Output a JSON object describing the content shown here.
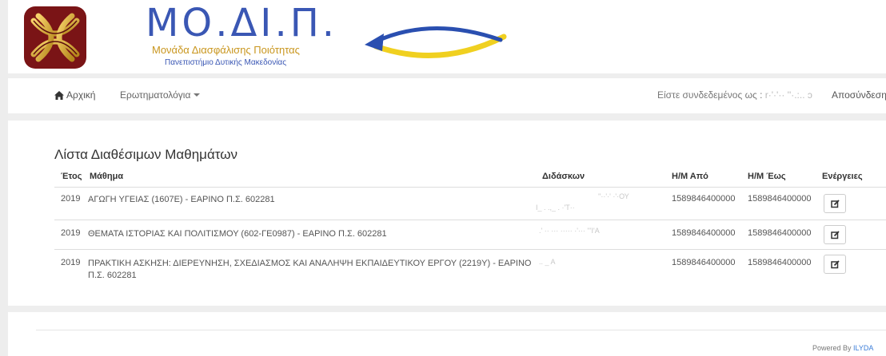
{
  "header": {
    "logo_title": "ΜΟ.ΔΙ.Π.",
    "logo_subtitle": "Μονάδα Διασφάλισης Ποιότητας",
    "logo_university": "Πανεπιστήμιο Δυτικής Μακεδονίας"
  },
  "navbar": {
    "home_label": "Αρχική",
    "questionnaires_label": "Ερωτηματολόγια",
    "logged_in_label": "Είστε συνδεδεμένος ως :",
    "username_blurred": "r·'·'·· ''·.:.. ͻ",
    "logout_label": "Αποσύνδεση"
  },
  "panel": {
    "title": "Λίστα Διαθέσιμων Μαθημάτων",
    "columns": {
      "year": "Έτος",
      "course": "Μάθημα",
      "teacher": "Διδάσκων",
      "from": "Η/Μ Από",
      "to": "Η/Μ Έως",
      "actions": "Ενέργειες"
    },
    "rows": [
      {
        "year": "2019",
        "course": "ΑΓΩΓΗ ΥΓΕΙΑΣ (1607Ε) - ΕΑΡΙΝΟ Π.Σ. 602281",
        "teacher_line1": "''··'·' ·'·ΟΥ",
        "teacher_line2": "Ι_ . .,_ . ·'Τ··",
        "from": "1589846400000",
        "to": "1589846400000"
      },
      {
        "year": "2019",
        "course": "ΘΕΜΑΤΑ ΙΣΤΟΡΙΑΣ ΚΑΙ ΠΟΛΙΤΙΣΜΟΥ (602-ΓΕ0987) - ΕΑΡΙΝΟ Π.Σ. 602281",
        "teacher_line1": ".' ·· ···  ····· ·'···  '''Ι'Α",
        "teacher_line2": "",
        "from": "1589846400000",
        "to": "1589846400000"
      },
      {
        "year": "2019",
        "course": "ΠΡΑΚΤΙΚΗ ΑΣΚΗΣΗ: ΔΙΕΡΕΥΝΗΣΗ, ΣΧΕΔΙΑΣΜΟΣ ΚΑΙ ΑΝΑΛΗΨΗ ΕΚΠΑΙΔΕΥΤΙΚΟΥ ΕΡΓΟΥ (2219Υ) - ΕΑΡΙΝΟ Π.Σ. 602281",
        "teacher_line1": "..                          _ Α",
        "teacher_line2": "",
        "from": "1589846400000",
        "to": "1589846400000"
      }
    ]
  },
  "footer": {
    "powered_by": "Powered By",
    "brand": "ILYDA"
  },
  "colors": {
    "brand_blue": "#3a57b4",
    "brand_gold": "#c9961e",
    "link_blue": "#3b7dd8",
    "band_gray": "#eeeeee"
  },
  "icons": [
    "university-knot-logo",
    "swoosh-arrow",
    "home-icon",
    "edit-icon"
  ]
}
